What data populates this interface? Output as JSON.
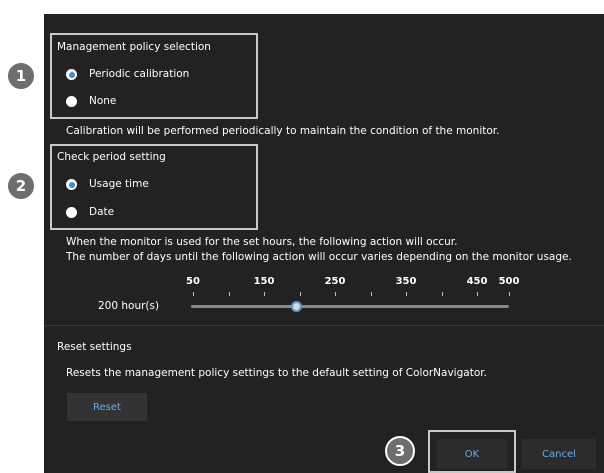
{
  "management_policy": {
    "heading": "Management policy selection",
    "options": [
      {
        "label": "Periodic calibration",
        "selected": true
      },
      {
        "label": "None",
        "selected": false
      }
    ],
    "description": "Calibration will be performed periodically to maintain the condition of the monitor."
  },
  "check_period": {
    "heading": "Check period setting",
    "options": [
      {
        "label": "Usage time",
        "selected": true
      },
      {
        "label": "Date",
        "selected": false
      }
    ],
    "description_line1": "When the monitor is used for the set hours, the following action will occur.",
    "description_line2": "The number of days until the following action will occur varies depending on the monitor usage."
  },
  "usage_slider": {
    "value_label": "200 hour(s)",
    "value": 200,
    "min": 50,
    "max": 500,
    "tick_labels": [
      "50",
      "150",
      "250",
      "350",
      "450",
      "500"
    ]
  },
  "reset": {
    "heading": "Reset settings",
    "description": "Resets the management policy settings to the default setting of ColorNavigator.",
    "button_label": "Reset"
  },
  "footer": {
    "ok_label": "OK",
    "cancel_label": "Cancel"
  },
  "callouts": {
    "badge1": "1",
    "badge2": "2",
    "badge3": "3"
  },
  "colors": {
    "panel_bg": "#222222",
    "accent": "#3a8fd6",
    "link_text": "#6fa8e8",
    "highlight_border": "#c8c8c8"
  }
}
